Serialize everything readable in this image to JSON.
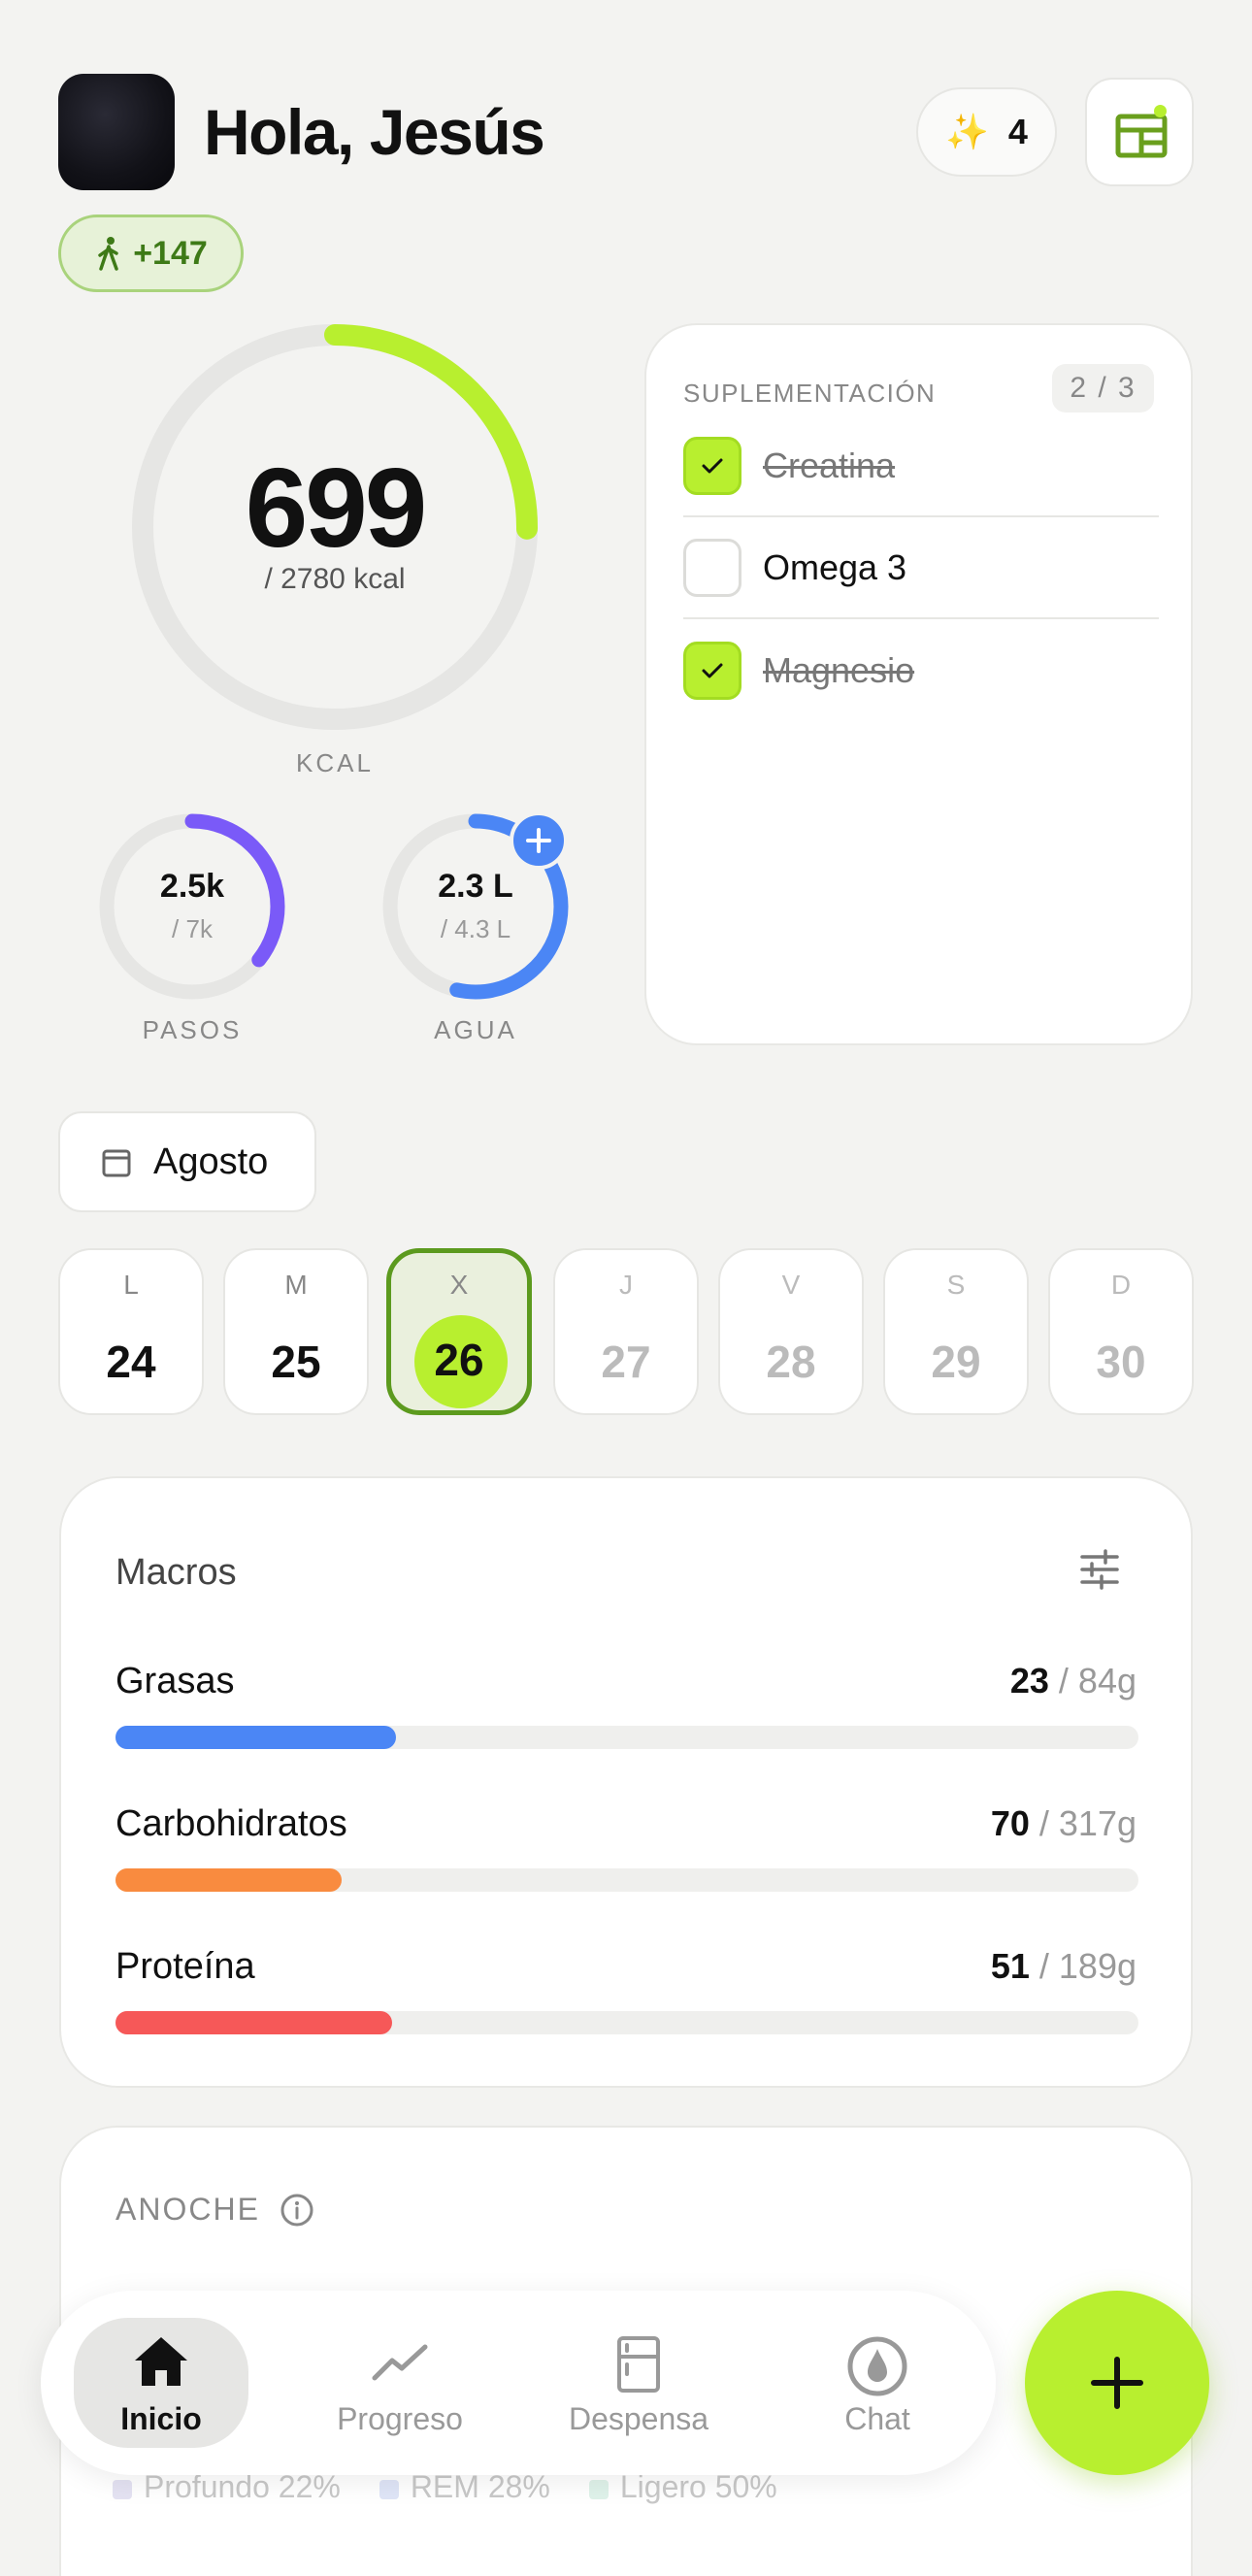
{
  "header": {
    "greeting": "Hola, Jesús",
    "sparkle_count": "4",
    "steps_bonus": "+147"
  },
  "calories": {
    "value": "699",
    "goal_text": "/ 2780 kcal",
    "label": "KCAL",
    "progress": 0.2514
  },
  "steps": {
    "value": "2.5k",
    "goal_text": "/ 7k",
    "label": "PASOS",
    "progress": 0.357
  },
  "water": {
    "value": "2.3 L",
    "goal_text": "/ 4.3 L",
    "label": "AGUA",
    "progress": 0.535
  },
  "supplements": {
    "title": "SUPLEMENTACIÓN",
    "count": "2 / 3",
    "items": [
      {
        "name": "Creatina",
        "done": true
      },
      {
        "name": "Omega 3",
        "done": false
      },
      {
        "name": "Magnesio",
        "done": true
      }
    ]
  },
  "month": "Agosto",
  "week": [
    {
      "letter": "L",
      "num": "24"
    },
    {
      "letter": "M",
      "num": "25"
    },
    {
      "letter": "X",
      "num": "26"
    },
    {
      "letter": "J",
      "num": "27"
    },
    {
      "letter": "V",
      "num": "28"
    },
    {
      "letter": "S",
      "num": "29"
    },
    {
      "letter": "D",
      "num": "30"
    }
  ],
  "macros": {
    "title": "Macros",
    "items": [
      {
        "name": "Grasas",
        "current": "23",
        "goal": "/ 84g",
        "progress": 0.274,
        "color": "#4b86f5"
      },
      {
        "name": "Carbohidratos",
        "current": "70",
        "goal": "/ 317g",
        "progress": 0.221,
        "color": "#f98b3f"
      },
      {
        "name": "Proteína",
        "current": "51",
        "goal": "/ 189g",
        "progress": 0.27,
        "color": "#f65858"
      }
    ]
  },
  "sleep": {
    "title": "ANOCHE",
    "legend": [
      "Profundo 22%",
      "REM 28%",
      "Ligero 50%"
    ]
  },
  "nav": {
    "items": [
      "Inicio",
      "Progreso",
      "Despensa",
      "Chat"
    ]
  },
  "colors": {
    "accent": "#b8ef2f",
    "steps_ring": "#7a5af8",
    "water_ring": "#4b86f5",
    "track": "#e6e6e4"
  }
}
